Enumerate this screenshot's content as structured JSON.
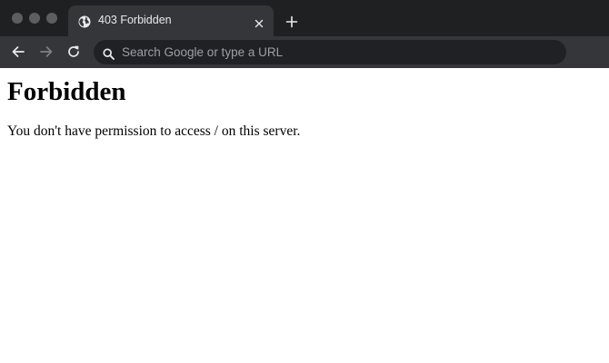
{
  "browser": {
    "tab": {
      "title": "403 Forbidden",
      "favicon": "globe-icon"
    },
    "omnibox": {
      "placeholder": "Search Google or type a URL"
    },
    "colors": {
      "tabstrip": "#1f2022",
      "toolbar": "#35363a",
      "omnibox": "#202124",
      "text": "#e8eaed"
    }
  },
  "page": {
    "title": "Forbidden",
    "message": "You don't have permission to access / on this server."
  }
}
